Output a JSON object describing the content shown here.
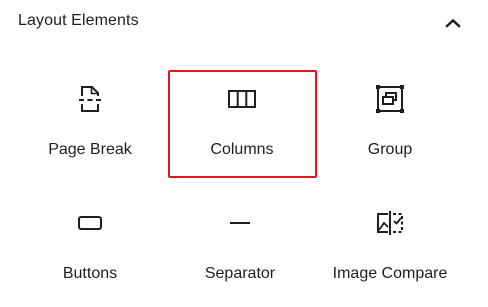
{
  "panel": {
    "title": "Layout Elements",
    "toggle_icon": "chevron-up-icon"
  },
  "blocks": [
    {
      "label": "Page Break",
      "icon": "page-break-icon"
    },
    {
      "label": "Columns",
      "icon": "columns-icon",
      "highlighted": true
    },
    {
      "label": "Group",
      "icon": "group-icon"
    },
    {
      "label": "Buttons",
      "icon": "buttons-icon"
    },
    {
      "label": "Separator",
      "icon": "separator-icon"
    },
    {
      "label": "Image Compare",
      "icon": "image-compare-icon"
    }
  ],
  "colors": {
    "text": "#1e1e1e",
    "highlight": "#e8131b",
    "background": "#ffffff"
  }
}
